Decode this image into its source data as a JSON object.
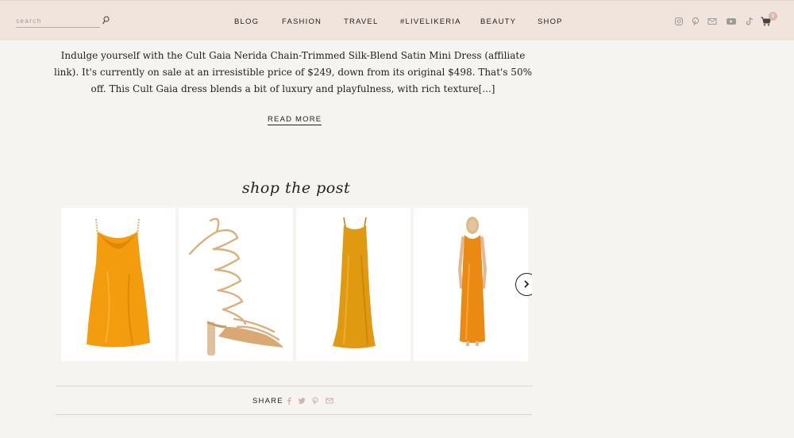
{
  "header": {
    "search": {
      "placeholder": "search",
      "value": ""
    },
    "nav": [
      {
        "label": "BLOG"
      },
      {
        "label": "FASHION"
      },
      {
        "label": "TRAVEL"
      },
      {
        "label": "#LIVELIKERIA"
      },
      {
        "label": "BEAUTY"
      },
      {
        "label": "SHOP"
      }
    ],
    "social": [
      "instagram-icon",
      "pinterest-icon",
      "email-icon",
      "youtube-icon",
      "tiktok-icon",
      "cart-icon"
    ],
    "cart_count": "0"
  },
  "post": {
    "excerpt": "Indulge yourself with the Cult Gaia Nerida Chain-Trimmed Silk-Blend Satin Mini Dress (affiliate link). It's currently on sale at an irresistible price of $249, down from its original $498. That's 50% off. This Cult Gaia dress blends a bit of luxury and playfulness, with rich texture[...]",
    "read_more": "READ MORE"
  },
  "shop": {
    "title": "shop the post",
    "products": [
      {
        "name": "orange-satin-mini-dress",
        "color": "#f29a0c"
      },
      {
        "name": "gold-lace-up-heel-sandals",
        "color": "#d9b07c"
      },
      {
        "name": "mustard-satin-maxi-dress",
        "color": "#e09a12"
      },
      {
        "name": "orange-satin-slip-dress-model",
        "color": "#ea8a12"
      }
    ],
    "next_icon": "chevron-right-icon"
  },
  "share": {
    "label": "SHARE",
    "icons": [
      "facebook-icon",
      "twitter-icon",
      "pinterest-icon",
      "email-icon"
    ]
  },
  "colors": {
    "background": "#f6f4f0",
    "header": "#f1e4dd",
    "accent": "#d9b9a9",
    "share_icon": "#d2b3a4"
  }
}
